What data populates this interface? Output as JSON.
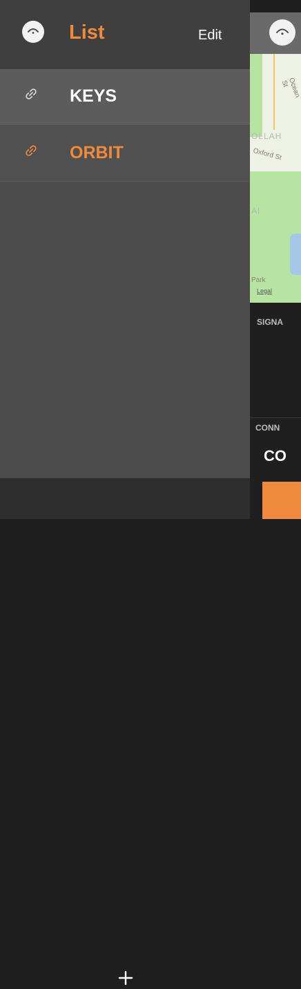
{
  "header": {
    "title": "List",
    "edit_label": "Edit"
  },
  "items": [
    {
      "label": "KEYS",
      "icon": "link-icon",
      "selected": true
    },
    {
      "label": "ORBIT",
      "icon": "link-icon",
      "selected": false
    }
  ],
  "bottom": {
    "add_label": "+"
  },
  "right_panel": {
    "map": {
      "street_1": "Ocean St",
      "street_2": "Oxford St",
      "area_1": "OLLAH",
      "area_2": "AI",
      "park": "Park",
      "legal": "Legal"
    },
    "signal_label": "SIGNA",
    "connection_label": "CONN",
    "connection_value": "CO"
  },
  "colors": {
    "accent": "#f08a3c",
    "drawer_bg": "#4b4b4b",
    "header_bg": "#3f3f3f"
  }
}
